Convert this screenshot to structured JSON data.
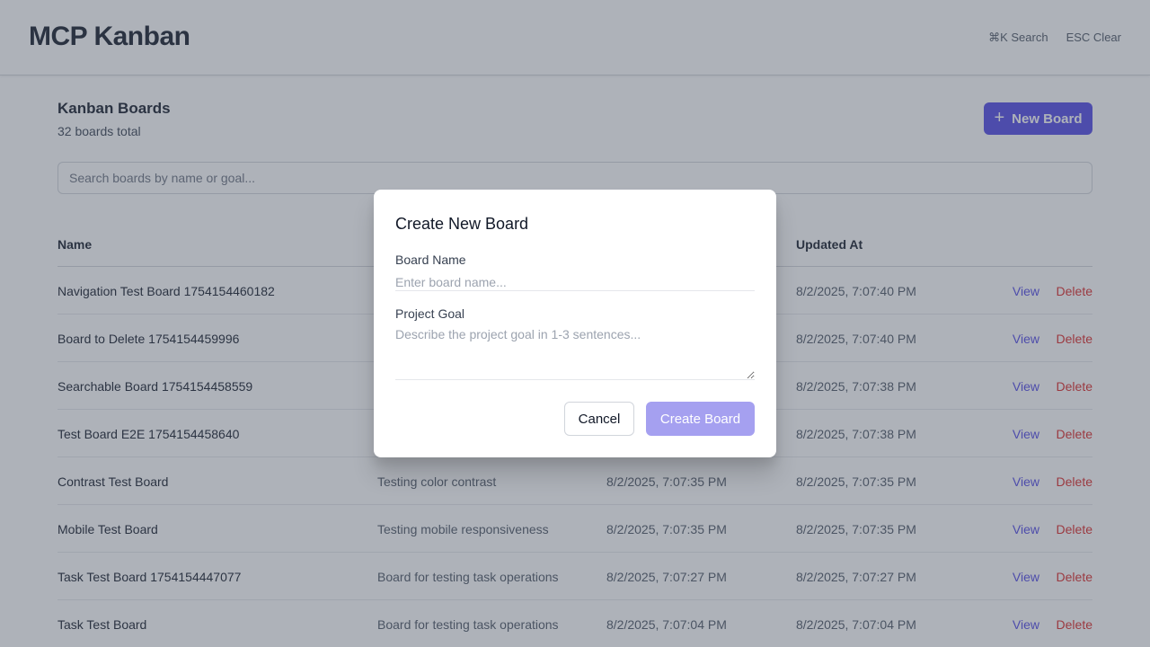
{
  "header": {
    "title": "MCP Kanban",
    "shortcuts": [
      "⌘K Search",
      "ESC Clear"
    ]
  },
  "page": {
    "title": "Kanban Boards",
    "count": "32 boards total",
    "new_board_label": "New Board",
    "new_board_icon": "plus-icon",
    "search_placeholder": "Search boards by name or goal..."
  },
  "table": {
    "columns": [
      "Name",
      "Updated At"
    ],
    "rows": [
      {
        "name": "Navigation Test Board 1754154460182",
        "goal": "",
        "created": "",
        "updated": "8/2/2025, 7:07:40 PM",
        "view": "View",
        "delete": "Delete"
      },
      {
        "name": "Board to Delete 1754154459996",
        "goal": "",
        "created": "",
        "updated": "8/2/2025, 7:07:40 PM",
        "view": "View",
        "delete": "Delete"
      },
      {
        "name": "Searchable Board 1754154458559",
        "goal": "",
        "created": "",
        "updated": "8/2/2025, 7:07:38 PM",
        "view": "View",
        "delete": "Delete"
      },
      {
        "name": "Test Board E2E 1754154458640",
        "goal": "",
        "created": "",
        "updated": "8/2/2025, 7:07:38 PM",
        "view": "View",
        "delete": "Delete"
      },
      {
        "name": "Contrast Test Board",
        "goal": "Testing color contrast",
        "created": "8/2/2025, 7:07:35 PM",
        "updated": "8/2/2025, 7:07:35 PM",
        "view": "View",
        "delete": "Delete"
      },
      {
        "name": "Mobile Test Board",
        "goal": "Testing mobile responsiveness",
        "created": "8/2/2025, 7:07:35 PM",
        "updated": "8/2/2025, 7:07:35 PM",
        "view": "View",
        "delete": "Delete"
      },
      {
        "name": "Task Test Board 1754154447077",
        "goal": "Board for testing task operations",
        "created": "8/2/2025, 7:07:27 PM",
        "updated": "8/2/2025, 7:07:27 PM",
        "view": "View",
        "delete": "Delete"
      },
      {
        "name": "Task Test Board",
        "goal": "Board for testing task operations",
        "created": "8/2/2025, 7:07:04 PM",
        "updated": "8/2/2025, 7:07:04 PM",
        "view": "View",
        "delete": "Delete"
      }
    ]
  },
  "modal": {
    "title": "Create New Board",
    "name_label": "Board Name",
    "name_placeholder": "Enter board name...",
    "goal_label": "Project Goal",
    "goal_placeholder": "Describe the project goal in 1-3 sentences...",
    "cancel_label": "Cancel",
    "create_label": "Create Board"
  },
  "colors": {
    "accent": "#4f46e5",
    "danger": "#dc2626",
    "create_disabled": "#a5a0f0"
  }
}
